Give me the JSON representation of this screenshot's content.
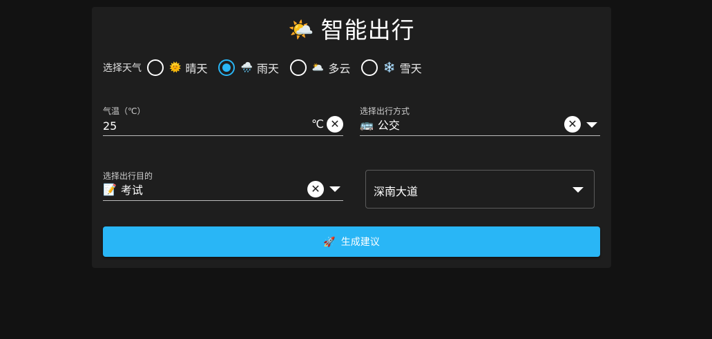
{
  "header": {
    "emoji": "🌤️",
    "title": "智能出行"
  },
  "weather": {
    "label": "选择天气",
    "selected": "雨天",
    "options": [
      {
        "emoji": "🌞",
        "label": "晴天",
        "checked": false
      },
      {
        "emoji": "🌧️",
        "label": "雨天",
        "checked": true
      },
      {
        "emoji": "🌥️",
        "label": "多云",
        "checked": false
      },
      {
        "emoji": "❄️",
        "label": "雪天",
        "checked": false
      }
    ]
  },
  "temperature": {
    "label": "气温（℃）",
    "value": "25",
    "unit": "℃",
    "clear_icon": "close-icon"
  },
  "transport": {
    "label": "选择出行方式",
    "emoji": "🚌",
    "value": "公交",
    "clear_icon": "close-icon",
    "dropdown_icon": "arrow-drop-down-icon"
  },
  "purpose": {
    "label": "选择出行目的",
    "emoji": "📝",
    "value": "考试",
    "clear_icon": "close-icon",
    "dropdown_icon": "arrow-drop-down-icon"
  },
  "location": {
    "value": "深南大道",
    "dropdown_icon": "arrow-drop-down-icon"
  },
  "submit": {
    "emoji": "🚀",
    "label": "生成建议"
  },
  "colors": {
    "background": "#121212",
    "card": "#1e1e1e",
    "accent": "#29b6f6"
  }
}
